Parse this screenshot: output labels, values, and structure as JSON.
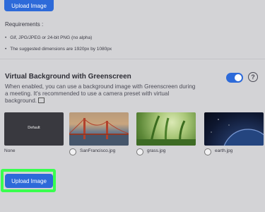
{
  "top": {
    "upload_label": "Upload Image"
  },
  "requirements": {
    "title": "Requirements :",
    "items": [
      "Gif, JPG/JPEG or 24-bit PNG (no alpha)",
      "The suggested dimensions are 1920px by 1080px"
    ]
  },
  "virtual_background": {
    "title": "Virtual Background with Greenscreen",
    "description": "When enabled, you can use a background image with Greenscreen during a meeting. It's recommended to use a camera preset with virtual background.",
    "toggle_enabled": true,
    "help_icon": "question-icon",
    "thumbnails": [
      {
        "name": "default",
        "caption": "Default",
        "label": "None"
      },
      {
        "name": "sanfrancisco",
        "label": "SanFrancisco.jpg"
      },
      {
        "name": "grass",
        "label": "grass.jpg"
      },
      {
        "name": "earth",
        "label": "earth.jpg"
      }
    ],
    "upload_label": "Upload Image"
  },
  "colors": {
    "accent": "#2d6ad9",
    "highlight": "#39ff4f",
    "background": "#d3d3d6"
  }
}
